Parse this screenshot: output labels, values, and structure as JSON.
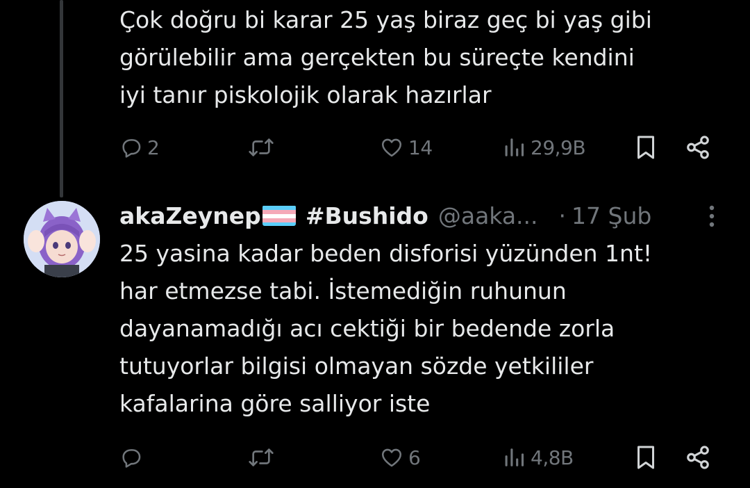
{
  "tweet1": {
    "text": "Çok doğru bi karar 25 yaş biraz geç bi yaş gibi\ngörülebilir ama gerçekten bu süreçte kendini\niyi tanır piskolojik olarak hazırlar",
    "actions": {
      "reply_count": "2",
      "like_count": "14",
      "views_count": "29,9B"
    }
  },
  "tweet2": {
    "display_name": "akaZeynep",
    "flag_icon": "transgender-flag-icon",
    "hashtag": "#Bushido",
    "handle": "@aaka...",
    "separator": "·",
    "timestamp": "17 Şub",
    "text": "25 yasina kadar beden disforisi yüzünden 1nt!\nhar etmezse tabi. İstemediğin ruhunun\ndayanamadığı acı cektiği bir bedende zorla\ntutuyorlar bilgisi olmayan sözde yetkililer\nkafalarina göre salliyor iste",
    "actions": {
      "reply_count": "",
      "like_count": "6",
      "views_count": "4,8B"
    }
  },
  "colors": {
    "background": "#000000",
    "text_primary": "#e7e9ea",
    "text_secondary": "#71767b",
    "thread_line": "#333639",
    "flag_blue": "#5bcefa",
    "flag_pink": "#f5a9b8",
    "flag_white": "#ffffff"
  },
  "icons": [
    "reply-icon",
    "retweet-icon",
    "like-icon",
    "views-icon",
    "bookmark-icon",
    "share-icon",
    "more-icon"
  ]
}
